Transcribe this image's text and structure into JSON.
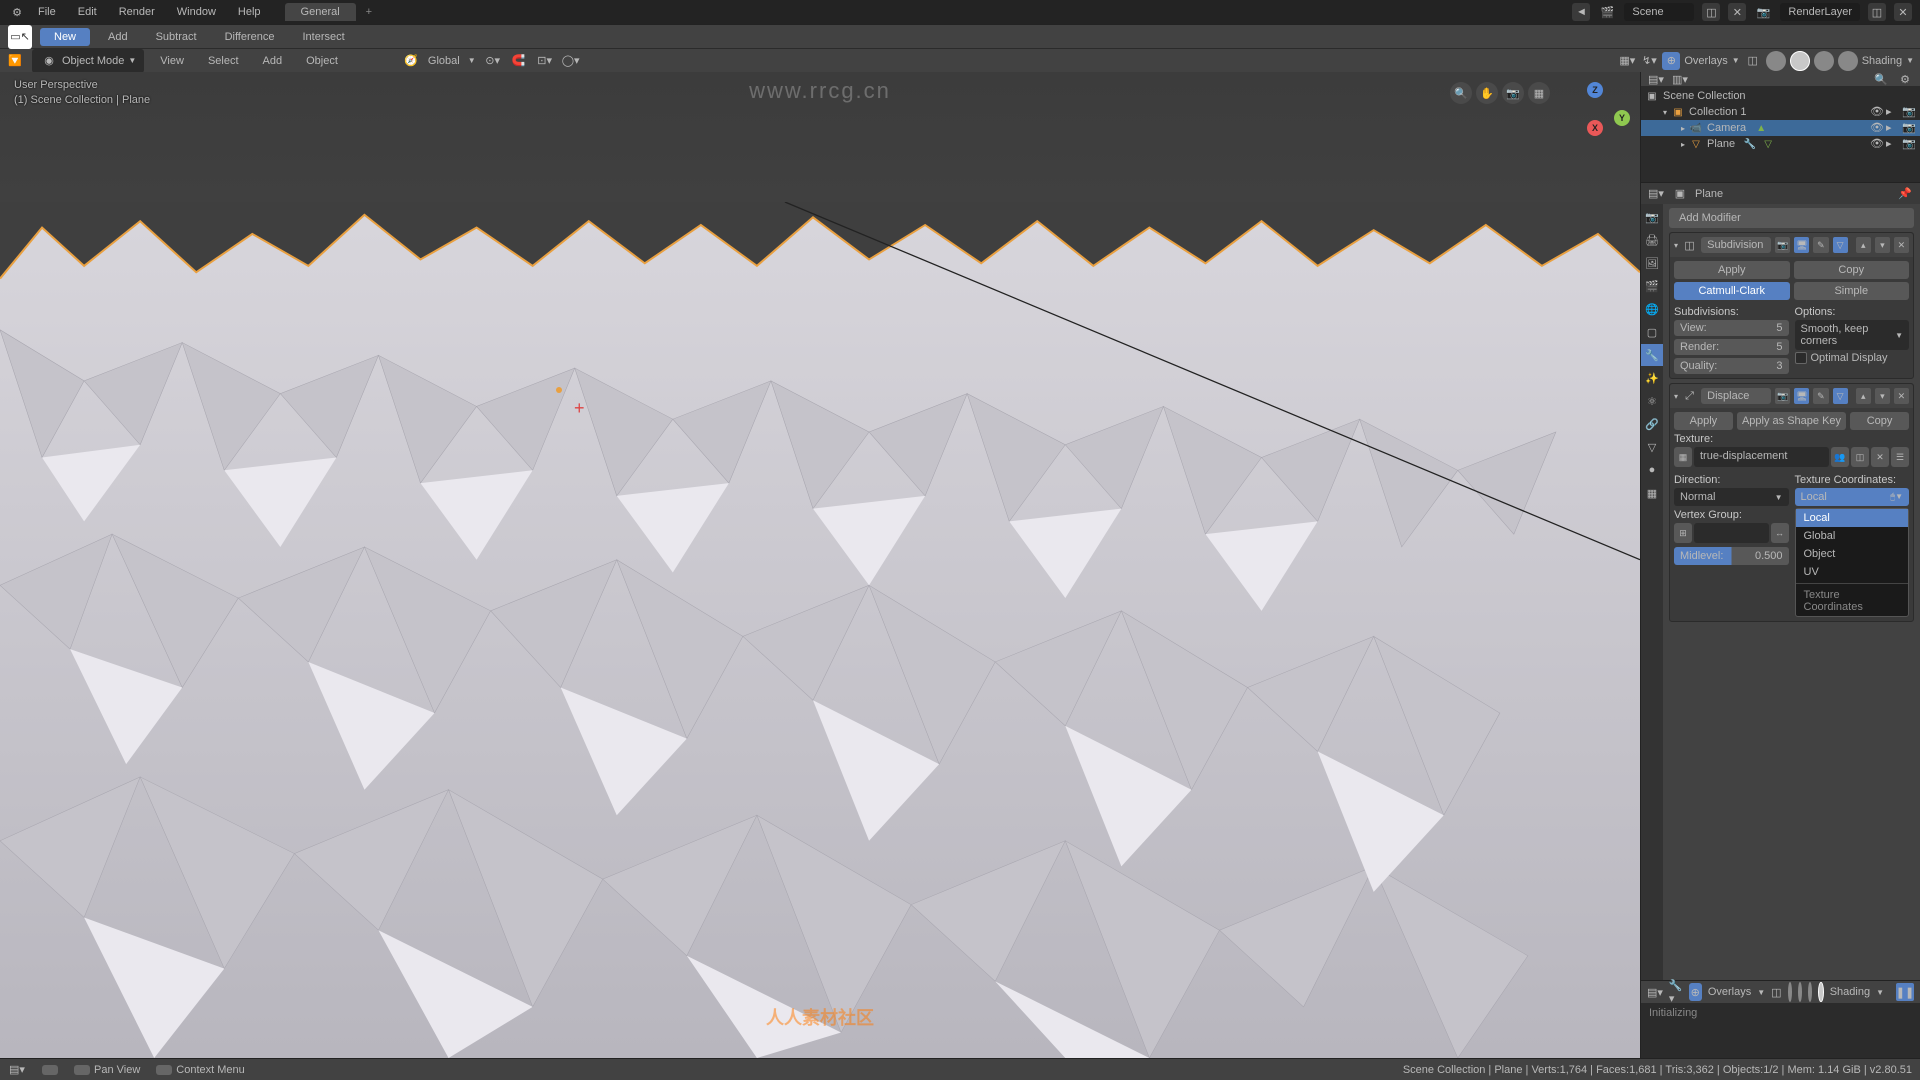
{
  "watermark": "www.rrcg.cn",
  "watermark_logo": "人人素材社区",
  "top_menu": [
    "File",
    "Edit",
    "Render",
    "Window",
    "Help"
  ],
  "workspace": "General",
  "scene_label": "Scene",
  "render_layer": "RenderLayer",
  "toolbar": {
    "new": "New",
    "add": "Add",
    "subtract": "Subtract",
    "difference": "Difference",
    "intersect": "Intersect"
  },
  "view_header": {
    "mode": "Object Mode",
    "menus": [
      "View",
      "Select",
      "Add",
      "Object"
    ],
    "orientation": "Global",
    "overlays": "Overlays",
    "shading": "Shading"
  },
  "viewport_info": {
    "line1": "User Perspective",
    "line2": "(1) Scene Collection | Plane"
  },
  "gizmo": {
    "x": "X",
    "y": "Y",
    "z": "Z"
  },
  "outliner": {
    "root": "Scene Collection",
    "collection": "Collection 1",
    "camera": "Camera",
    "plane": "Plane"
  },
  "object_bar": "Plane",
  "add_modifier_label": "Add Modifier",
  "subdivision": {
    "name": "Subdivision",
    "apply": "Apply",
    "copy": "Copy",
    "mode1": "Catmull-Clark",
    "mode2": "Simple",
    "left_title": "Subdivisions:",
    "view": "View:",
    "view_val": "5",
    "render": "Render:",
    "render_val": "5",
    "quality": "Quality:",
    "quality_val": "3",
    "right_title": "Options:",
    "uv_smooth": "Smooth, keep corners",
    "optimal": "Optimal Display"
  },
  "displace": {
    "name": "Displace",
    "apply": "Apply",
    "apply_shape": "Apply as Shape Key",
    "copy": "Copy",
    "texture_label": "Texture:",
    "texture_name": "true-displacement",
    "direction_label": "Direction:",
    "direction": "Normal",
    "texcoord_label": "Texture Coordinates:",
    "texcoord": "Local",
    "vgroup_label": "Vertex Group:",
    "midlevel_label": "Midlevel:",
    "midlevel_val": "0.500",
    "dropdown": {
      "local": "Local",
      "global": "Global",
      "object": "Object",
      "uv": "UV",
      "title": "Texture Coordinates"
    }
  },
  "preview": {
    "overlays": "Overlays",
    "shading": "Shading",
    "status": "Initializing"
  },
  "status": {
    "pan": "Pan View",
    "context": "Context Menu",
    "info": "Scene Collection | Plane | Verts:1,764 | Faces:1,681 | Tris:3,362 | Objects:1/2 | Mem: 1.14 GiB | v2.80.51"
  }
}
